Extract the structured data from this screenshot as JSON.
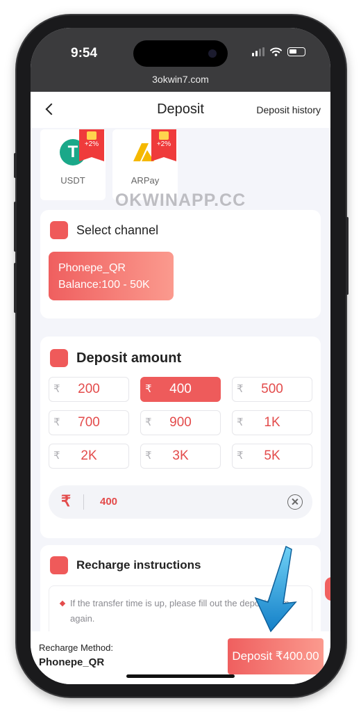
{
  "status_bar": {
    "time": "9:54",
    "url": "3okwin7.com"
  },
  "nav": {
    "title": "Deposit",
    "history_label": "Deposit history"
  },
  "methods": [
    {
      "label": "USDT",
      "bonus": "+2%"
    },
    {
      "label": "ARPay",
      "bonus": "+2%"
    }
  ],
  "watermark": "OKWINAPP.CC",
  "channel": {
    "heading": "Select channel",
    "name": "Phonepe_QR",
    "balance": "Balance:100 - 50K"
  },
  "amount": {
    "heading": "Deposit amount",
    "currency_symbol": "₹",
    "options": [
      "200",
      "400",
      "500",
      "700",
      "900",
      "1K",
      "2K",
      "3K",
      "5K"
    ],
    "selected": "400",
    "input_value": "400"
  },
  "instructions": {
    "heading": "Recharge instructions",
    "text": "If the transfer time is up, please fill out the deposit form again."
  },
  "bottom": {
    "method_title": "Recharge Method:",
    "method_name": "Phonepe_QR",
    "deposit_button": "Deposit ₹400.00"
  },
  "colors": {
    "accent": "#ee5b5b",
    "arrow": "#1e9fd8"
  }
}
